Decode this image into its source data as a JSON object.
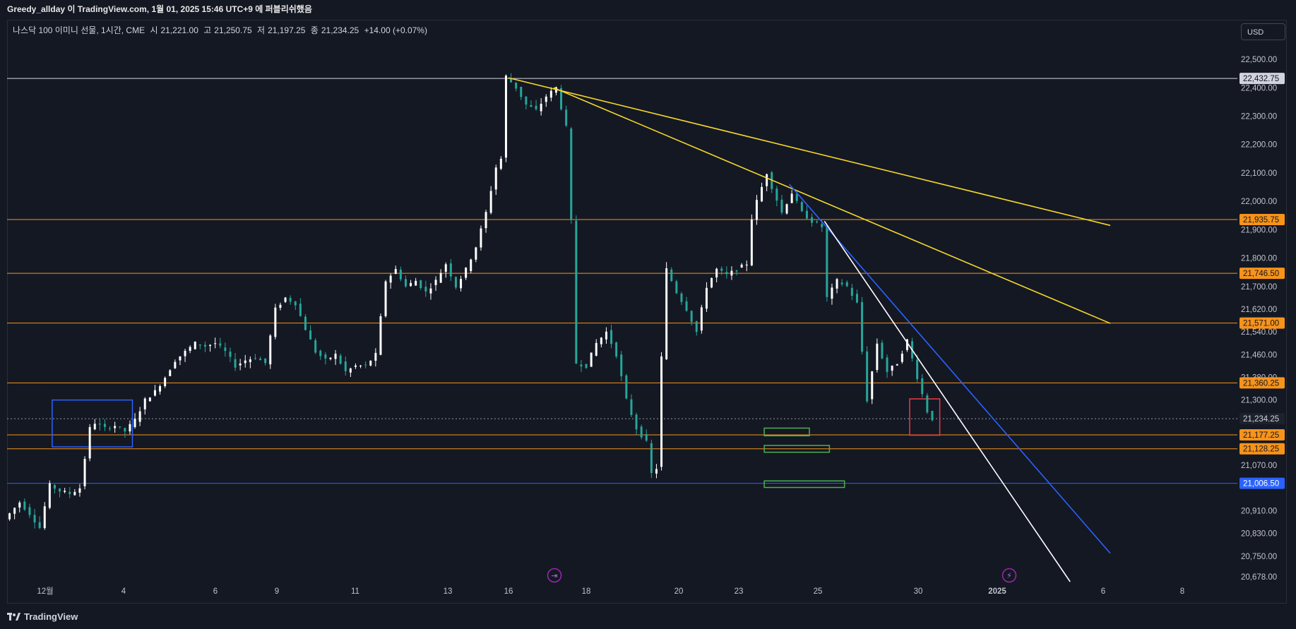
{
  "header": {
    "publish_text": "Greedy_allday 이 TradingView.com, 1월 01, 2025 15:46 UTC+9 에 퍼블리쉬했음"
  },
  "legend": {
    "symbol": "나스닥 100 이미니 선물, 1시간, CME",
    "open_label": "시",
    "open": "21,221.00",
    "high_label": "고",
    "high": "21,250.75",
    "low_label": "저",
    "low": "21,197.25",
    "close_label": "종",
    "close": "21,234.25",
    "change": "+14.00 (+0.07%)"
  },
  "currency": "USD",
  "brand": "TradingView",
  "colors": {
    "background": "#141823",
    "candle": "#26a69a",
    "candle_alt": "#ffffff",
    "orange_level": "#f7931a",
    "blue_level": "#2962ff",
    "yellow_trend": "#f5d72a",
    "white_trend": "#ffffff",
    "blue_trend": "#2962ff",
    "green_box": "#4caf50",
    "red_box": "#f23645",
    "blue_box": "#2962ff"
  },
  "chart_data": {
    "type": "candlestick",
    "price_axis": {
      "ticks": [
        "22,500.00",
        "22,400.00",
        "22,300.00",
        "22,200.00",
        "22,100.00",
        "22,000.00",
        "21,900.00",
        "21,800.00",
        "21,700.00",
        "21,620.00",
        "21,540.00",
        "21,460.00",
        "21,380.00",
        "21,300.00",
        "21,070.00",
        "20,910.00",
        "20,830.00",
        "20,750.00",
        "20,678.00"
      ],
      "tick_values": [
        22500,
        22400,
        22300,
        22200,
        22100,
        22000,
        21900,
        21800,
        21700,
        21620,
        21540,
        21460,
        21380,
        21300,
        21070,
        20910,
        20830,
        20750,
        20678
      ],
      "ylim": [
        20660,
        22540
      ]
    },
    "time_axis": {
      "labels": [
        "12월",
        "4",
        "6",
        "9",
        "11",
        "13",
        "16",
        "18",
        "20",
        "23",
        "25",
        "30",
        "2025",
        "6",
        "8"
      ]
    },
    "price_levels": [
      {
        "label": "22,432.75",
        "value": 22432.75,
        "color": "#d1d4dc",
        "tag_bg": "#d1d4dc",
        "tag_fg": "#131722"
      },
      {
        "label": "21,935.75",
        "value": 21935.75,
        "color": "#f7931a",
        "tag_bg": "#f7931a",
        "tag_fg": "#131722"
      },
      {
        "label": "21,746.50",
        "value": 21746.5,
        "color": "#f7931a",
        "tag_bg": "#f7931a",
        "tag_fg": "#131722"
      },
      {
        "label": "21,571.00",
        "value": 21571.0,
        "color": "#f7931a",
        "tag_bg": "#f7931a",
        "tag_fg": "#131722"
      },
      {
        "label": "21,360.25",
        "value": 21360.25,
        "color": "#f7931a",
        "tag_bg": "#f7931a",
        "tag_fg": "#131722"
      },
      {
        "label": "21,234.25",
        "value": 21234.25,
        "color": "#9598a1",
        "tag_bg": "#1e222d",
        "tag_fg": "#d1d4dc",
        "dotted": true
      },
      {
        "label": "21,177.25",
        "value": 21177.25,
        "color": "#f7931a",
        "tag_bg": "#f7931a",
        "tag_fg": "#131722"
      },
      {
        "label": "21,128.25",
        "value": 21128.25,
        "color": "#f7931a",
        "tag_bg": "#f7931a",
        "tag_fg": "#131722"
      },
      {
        "label": "21,006.50",
        "value": 21006.5,
        "color": "#2962ff",
        "tag_bg": "#2962ff",
        "tag_fg": "#ffffff"
      }
    ],
    "price_path": [
      [
        0,
        20880
      ],
      [
        3,
        20940
      ],
      [
        5,
        20900
      ],
      [
        7,
        20850
      ],
      [
        9,
        21000
      ],
      [
        11,
        20980
      ],
      [
        13,
        20970
      ],
      [
        15,
        20990
      ],
      [
        17,
        21200
      ],
      [
        18,
        21220
      ],
      [
        20,
        21200
      ],
      [
        22,
        21210
      ],
      [
        24,
        21190
      ],
      [
        26,
        21230
      ],
      [
        28,
        21300
      ],
      [
        30,
        21330
      ],
      [
        32,
        21380
      ],
      [
        34,
        21440
      ],
      [
        36,
        21470
      ],
      [
        38,
        21500
      ],
      [
        40,
        21490
      ],
      [
        42,
        21500
      ],
      [
        44,
        21470
      ],
      [
        46,
        21420
      ],
      [
        48,
        21440
      ],
      [
        50,
        21450
      ],
      [
        52,
        21430
      ],
      [
        54,
        21620
      ],
      [
        56,
        21660
      ],
      [
        58,
        21640
      ],
      [
        60,
        21550
      ],
      [
        62,
        21470
      ],
      [
        64,
        21440
      ],
      [
        66,
        21460
      ],
      [
        68,
        21400
      ],
      [
        70,
        21420
      ],
      [
        72,
        21420
      ],
      [
        74,
        21460
      ],
      [
        76,
        21720
      ],
      [
        78,
        21760
      ],
      [
        80,
        21700
      ],
      [
        82,
        21720
      ],
      [
        84,
        21680
      ],
      [
        86,
        21720
      ],
      [
        88,
        21780
      ],
      [
        90,
        21700
      ],
      [
        92,
        21760
      ],
      [
        94,
        21840
      ],
      [
        96,
        21960
      ],
      [
        98,
        22120
      ],
      [
        99,
        22150
      ],
      [
        100,
        22440
      ],
      [
        102,
        22400
      ],
      [
        104,
        22340
      ],
      [
        106,
        22320
      ],
      [
        108,
        22370
      ],
      [
        110,
        22400
      ],
      [
        112,
        22260
      ],
      [
        113,
        21930
      ],
      [
        114,
        21430
      ],
      [
        116,
        21420
      ],
      [
        118,
        21500
      ],
      [
        120,
        21540
      ],
      [
        122,
        21460
      ],
      [
        124,
        21300
      ],
      [
        126,
        21200
      ],
      [
        128,
        21150
      ],
      [
        129,
        21040
      ],
      [
        130,
        21060
      ],
      [
        131,
        21450
      ],
      [
        132,
        21760
      ],
      [
        134,
        21680
      ],
      [
        136,
        21620
      ],
      [
        138,
        21540
      ],
      [
        140,
        21700
      ],
      [
        142,
        21760
      ],
      [
        144,
        21740
      ],
      [
        146,
        21760
      ],
      [
        148,
        21780
      ],
      [
        149,
        21940
      ],
      [
        150,
        22000
      ],
      [
        152,
        22100
      ],
      [
        153,
        22050
      ],
      [
        155,
        21960
      ],
      [
        157,
        22030
      ],
      [
        159,
        21960
      ],
      [
        161,
        21930
      ],
      [
        163,
        21910
      ],
      [
        164,
        21660
      ],
      [
        166,
        21720
      ],
      [
        168,
        21700
      ],
      [
        170,
        21640
      ],
      [
        172,
        21300
      ],
      [
        174,
        21500
      ],
      [
        176,
        21400
      ],
      [
        178,
        21430
      ],
      [
        180,
        21510
      ],
      [
        182,
        21380
      ],
      [
        184,
        21260
      ],
      [
        185,
        21234
      ]
    ],
    "trend_lines": [
      {
        "color": "#f5d72a",
        "from": [
          100,
          22435
        ],
        "to": [
          220,
          21915
        ]
      },
      {
        "color": "#f5d72a",
        "from": [
          109,
          22400
        ],
        "to": [
          220,
          21570
        ]
      },
      {
        "color": "#2962ff",
        "from": [
          156,
          22060
        ],
        "to": [
          220,
          20760
        ]
      },
      {
        "color": "#ffffff",
        "from": [
          163,
          21930
        ],
        "to": [
          212,
          20660
        ]
      }
    ],
    "boxes": [
      {
        "color": "#2962ff",
        "x0": 9,
        "x1": 25,
        "y0": 21135,
        "y1": 21300
      },
      {
        "color": "#4caf50",
        "x0": 151,
        "x1": 160,
        "y0": 21174,
        "y1": 21201
      },
      {
        "color": "#4caf50",
        "x0": 151,
        "x1": 164,
        "y0": 21116,
        "y1": 21140
      },
      {
        "color": "#4caf50",
        "x0": 151,
        "x1": 167,
        "y0": 20992,
        "y1": 21015
      },
      {
        "color": "#f23645",
        "x0": 180,
        "x1": 186,
        "y0": 21176,
        "y1": 21304
      }
    ]
  }
}
